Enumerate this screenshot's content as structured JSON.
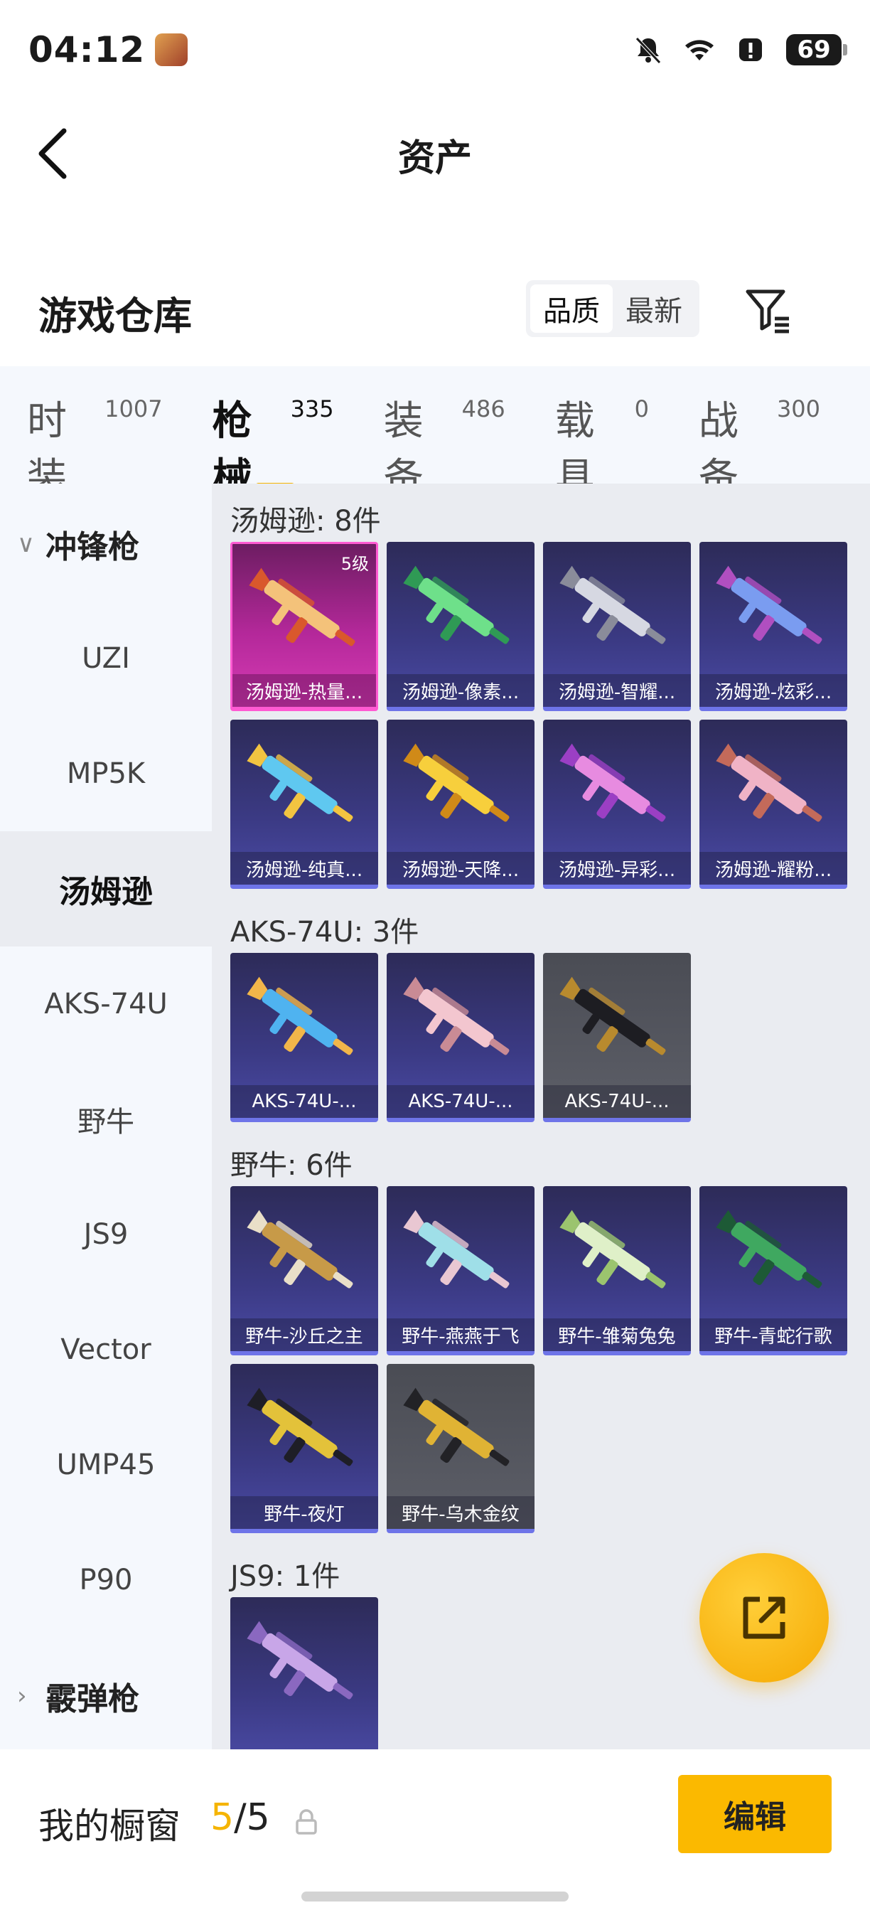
{
  "status_bar": {
    "time": "04:12",
    "battery": "69"
  },
  "header": {
    "title": "资产"
  },
  "section": {
    "title": "游戏仓库",
    "sort_options": [
      "品质",
      "最新"
    ],
    "active_sort": 0
  },
  "category_tabs": [
    {
      "label": "时装",
      "count": "1007"
    },
    {
      "label": "枪械",
      "count": "335"
    },
    {
      "label": "装备",
      "count": "486"
    },
    {
      "label": "载具",
      "count": "0"
    },
    {
      "label": "战备",
      "count": "300"
    }
  ],
  "active_tab": 1,
  "sidebar": {
    "group_open": {
      "chevron": "∨",
      "label": "冲锋枪"
    },
    "items": [
      "UZI",
      "MP5K",
      "汤姆逊",
      "AKS-74U",
      "野牛",
      "JS9",
      "Vector",
      "UMP45",
      "P90"
    ],
    "active_item": 2,
    "group_closed": {
      "chevron": "›",
      "label": "霰弹枪"
    }
  },
  "groups": [
    {
      "title": "汤姆逊: 8件",
      "items": [
        {
          "name": "汤姆逊-热量...",
          "level": "5级",
          "tier": "purple",
          "colors": [
            "#f4c27a",
            "#d9582c"
          ]
        },
        {
          "name": "汤姆逊-像素...",
          "tier": "blue",
          "colors": [
            "#6ee08a",
            "#2f9a55"
          ]
        },
        {
          "name": "汤姆逊-智耀...",
          "tier": "blue",
          "colors": [
            "#d6d8e2",
            "#8a8c9a"
          ]
        },
        {
          "name": "汤姆逊-炫彩...",
          "tier": "blue",
          "colors": [
            "#7a9cf0",
            "#b04fc0"
          ]
        },
        {
          "name": "汤姆逊-纯真...",
          "tier": "blue",
          "colors": [
            "#5fc8f0",
            "#f2c441"
          ]
        },
        {
          "name": "汤姆逊-天降...",
          "tier": "blue",
          "colors": [
            "#f7cf3c",
            "#d08a18"
          ]
        },
        {
          "name": "汤姆逊-异彩...",
          "tier": "blue",
          "colors": [
            "#e78be0",
            "#9b3fc4"
          ]
        },
        {
          "name": "汤姆逊-耀粉...",
          "tier": "blue",
          "colors": [
            "#f0b3c6",
            "#c46a5a"
          ]
        }
      ]
    },
    {
      "title": "AKS-74U: 3件",
      "items": [
        {
          "name": "AKS-74U-...",
          "tier": "blue",
          "colors": [
            "#4fb3f0",
            "#f2b64a"
          ]
        },
        {
          "name": "AKS-74U-...",
          "tier": "blue",
          "colors": [
            "#f3c6cf",
            "#c98b95"
          ]
        },
        {
          "name": "AKS-74U-...",
          "tier": "grey",
          "colors": [
            "#1d1d22",
            "#b88a2e"
          ]
        }
      ]
    },
    {
      "title": "野牛: 6件",
      "items": [
        {
          "name": "野牛-沙丘之主",
          "tier": "blue",
          "colors": [
            "#c79a48",
            "#e9dfc8"
          ]
        },
        {
          "name": "野牛-燕燕于飞",
          "tier": "blue",
          "colors": [
            "#9fdfe8",
            "#e9c7d2"
          ]
        },
        {
          "name": "野牛-雏菊兔兔",
          "tier": "blue",
          "colors": [
            "#dff0c8",
            "#9bc46e"
          ]
        },
        {
          "name": "野牛-青蛇行歌",
          "tier": "blue",
          "colors": [
            "#3fa860",
            "#1d5a36"
          ]
        },
        {
          "name": "野牛-夜灯",
          "tier": "blue",
          "colors": [
            "#e3c23a",
            "#1e1e26"
          ]
        },
        {
          "name": "野牛-乌木金纹",
          "tier": "grey",
          "colors": [
            "#e0b334",
            "#222226"
          ]
        }
      ]
    },
    {
      "title": "JS9: 1件",
      "items": [
        {
          "name": "",
          "tier": "blue",
          "colors": [
            "#c8a6e8",
            "#8a68c0"
          ]
        }
      ]
    }
  ],
  "bottom_bar": {
    "window_label": "我的橱窗",
    "current": "5",
    "separator": "/",
    "total": "5",
    "edit_label": "编辑"
  },
  "theme": {
    "accent": "#f5b400",
    "sidebar_bg": "#f5f8fd",
    "content_bg": "#eaecf1"
  }
}
